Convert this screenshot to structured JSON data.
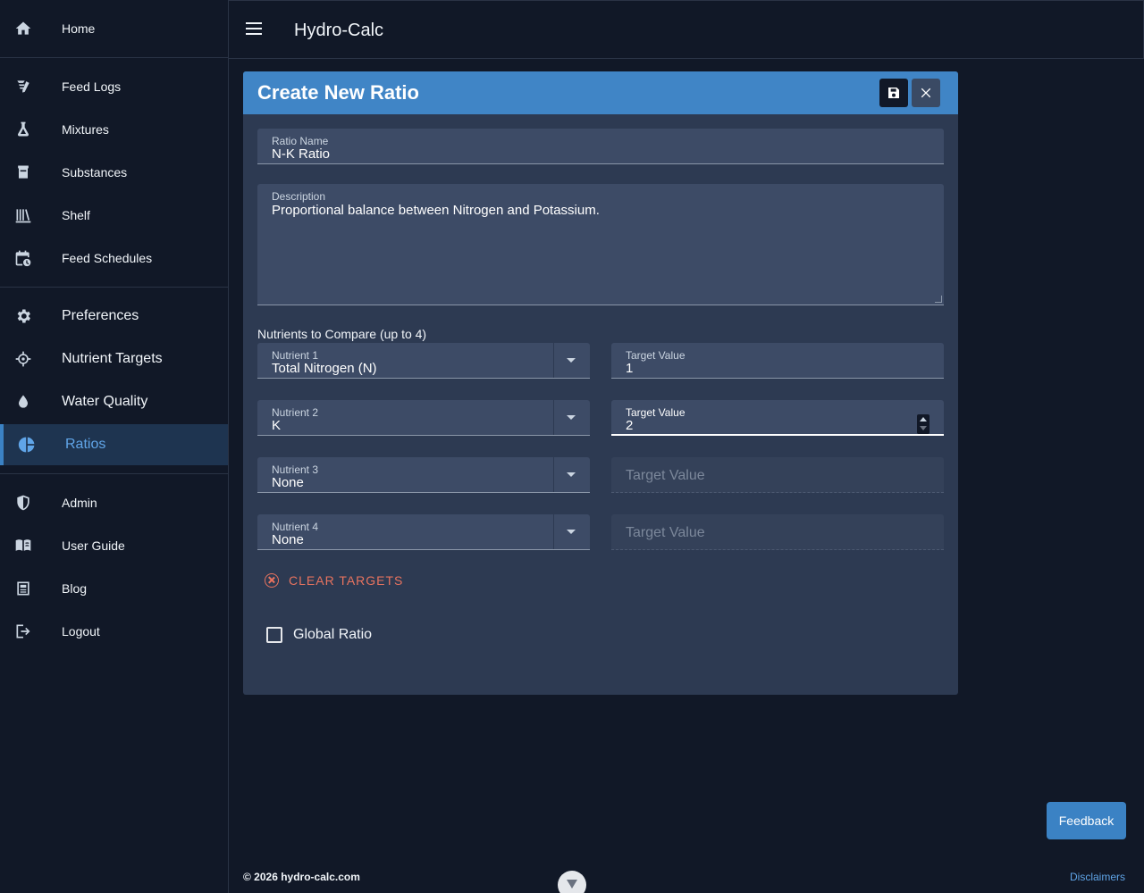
{
  "app": {
    "title": "Hydro-Calc"
  },
  "sidebar": {
    "items": [
      {
        "label": "Home",
        "icon": "home-icon"
      },
      {
        "label": "Feed Logs",
        "icon": "feed-logs-icon"
      },
      {
        "label": "Mixtures",
        "icon": "flask-icon"
      },
      {
        "label": "Substances",
        "icon": "container-icon"
      },
      {
        "label": "Shelf",
        "icon": "shelf-icon"
      },
      {
        "label": "Feed Schedules",
        "icon": "calendar-clock-icon"
      },
      {
        "label": "Preferences",
        "icon": "gear-icon"
      },
      {
        "label": "Nutrient Targets",
        "icon": "crosshair-icon"
      },
      {
        "label": "Water Quality",
        "icon": "water-drop-icon"
      },
      {
        "label": "Ratios",
        "icon": "pie-chart-icon",
        "active": true
      },
      {
        "label": "Admin",
        "icon": "shield-icon"
      },
      {
        "label": "User Guide",
        "icon": "book-icon"
      },
      {
        "label": "Blog",
        "icon": "newspaper-icon"
      },
      {
        "label": "Logout",
        "icon": "logout-icon"
      }
    ]
  },
  "dialog": {
    "title": "Create New Ratio",
    "ratio_name": {
      "label": "Ratio Name",
      "value": "N-K Ratio"
    },
    "description": {
      "label": "Description",
      "value": "Proportional balance between Nitrogen and Potassium."
    },
    "nutrients_label": "Nutrients to Compare (up to 4)",
    "nutrients": [
      {
        "label": "Nutrient 1",
        "value": "Total Nitrogen (N)",
        "target_label": "Target Value",
        "target_value": "1"
      },
      {
        "label": "Nutrient 2",
        "value": "K",
        "target_label": "Target Value",
        "target_value": "2"
      },
      {
        "label": "Nutrient 3",
        "value": "None",
        "target_placeholder": "Target Value"
      },
      {
        "label": "Nutrient 4",
        "value": "None",
        "target_placeholder": "Target Value"
      }
    ],
    "clear_targets": "CLEAR TARGETS",
    "global_ratio": "Global Ratio"
  },
  "footer": {
    "feedback": "Feedback",
    "copyright": "© 2026 hydro-calc.com",
    "disclaimers": "Disclaimers"
  },
  "colors": {
    "header_blue": "#4085c6",
    "accent_blue": "#60a5e8",
    "danger": "#e8735f",
    "background": "#111827",
    "card": "#2d3a52"
  }
}
